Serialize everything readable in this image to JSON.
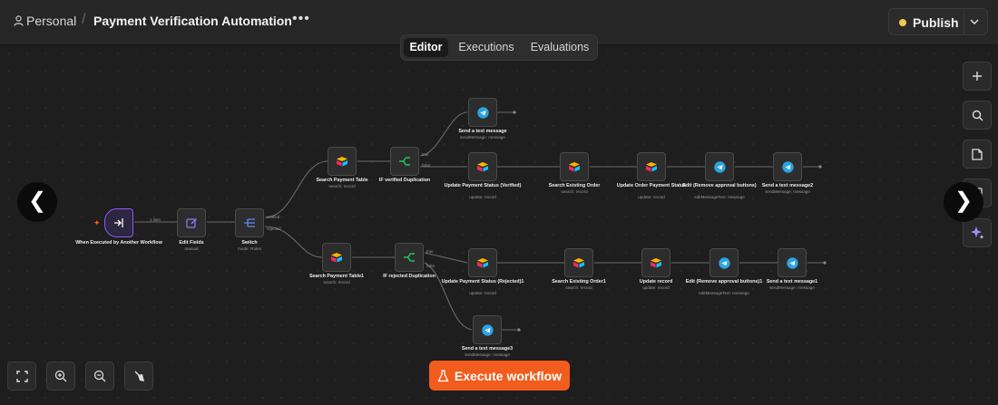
{
  "header": {
    "workspace": "Personal",
    "workflow_title": "Payment Verification Automation",
    "more_icon": "more-horizontal-icon",
    "publish_label": "Publish",
    "publish_status_color": "#f2c94c"
  },
  "tabs": [
    {
      "label": "Editor",
      "active": true
    },
    {
      "label": "Executions",
      "active": false
    },
    {
      "label": "Evaluations",
      "active": false
    }
  ],
  "nodes": {
    "trigger": {
      "label": "When Executed by Another Workflow",
      "sub": ""
    },
    "edit_fields": {
      "label": "Edit Fields",
      "sub": "manual"
    },
    "switch": {
      "label": "Switch",
      "sub": "mode: Rules"
    },
    "search_payment_table": {
      "label": "Search Payment Table",
      "sub": "search: record"
    },
    "if_verified": {
      "label": "IF verified Duplication",
      "sub": ""
    },
    "send_text_1": {
      "label": "Send a text message",
      "sub": "sendMessage: message"
    },
    "update_verified": {
      "label": "Update Payment Status (Verified)",
      "sub": "update: record"
    },
    "search_existing_order": {
      "label": "Search Existing Order",
      "sub": "search: record"
    },
    "update_order_status": {
      "label": "Update Order Payment Status",
      "sub": "update: record"
    },
    "edit_remove_buttons": {
      "label": "Edit (Remove approval buttons)",
      "sub": "editMessageText: message"
    },
    "send_text_2": {
      "label": "Send a text message2",
      "sub": "sendMessage: message"
    },
    "search_payment_table1": {
      "label": "Search Payment Table1",
      "sub": "search: record"
    },
    "if_rejected": {
      "label": "IF rejected Duplication",
      "sub": ""
    },
    "update_rejected": {
      "label": "Update Payment Status (Rejected)1",
      "sub": "update: record"
    },
    "search_existing_order1": {
      "label": "Search Existing Order1",
      "sub": "search: record"
    },
    "update_record": {
      "label": "Update record",
      "sub": "update: record"
    },
    "edit_remove_buttons1": {
      "label": "Edit (Remove approval buttons)1",
      "sub": "editMessageText: message"
    },
    "send_text_1b": {
      "label": "Send a text message1",
      "sub": "sendMessage: message"
    },
    "send_text_3": {
      "label": "Send a text message3",
      "sub": "sendMessage: message"
    }
  },
  "edge_labels": {
    "item_count": "1 item",
    "verified": "verified",
    "rejected": "rejected",
    "true_label": "true",
    "false_label": "false"
  },
  "right_toolbar": [
    {
      "name": "add-node-icon"
    },
    {
      "name": "search-icon"
    },
    {
      "name": "sticky-note-icon"
    },
    {
      "name": "panel-icon"
    },
    {
      "name": "ai-sparkle-icon"
    }
  ],
  "bottom_toolbar": [
    {
      "name": "fit-view-icon"
    },
    {
      "name": "zoom-in-icon"
    },
    {
      "name": "zoom-out-icon"
    },
    {
      "name": "tidy-up-icon"
    }
  ],
  "execute_button": {
    "label": "Execute workflow",
    "icon": "flask-icon",
    "color": "#f25c1c"
  },
  "nav": {
    "prev": "❮",
    "next": "❯"
  }
}
